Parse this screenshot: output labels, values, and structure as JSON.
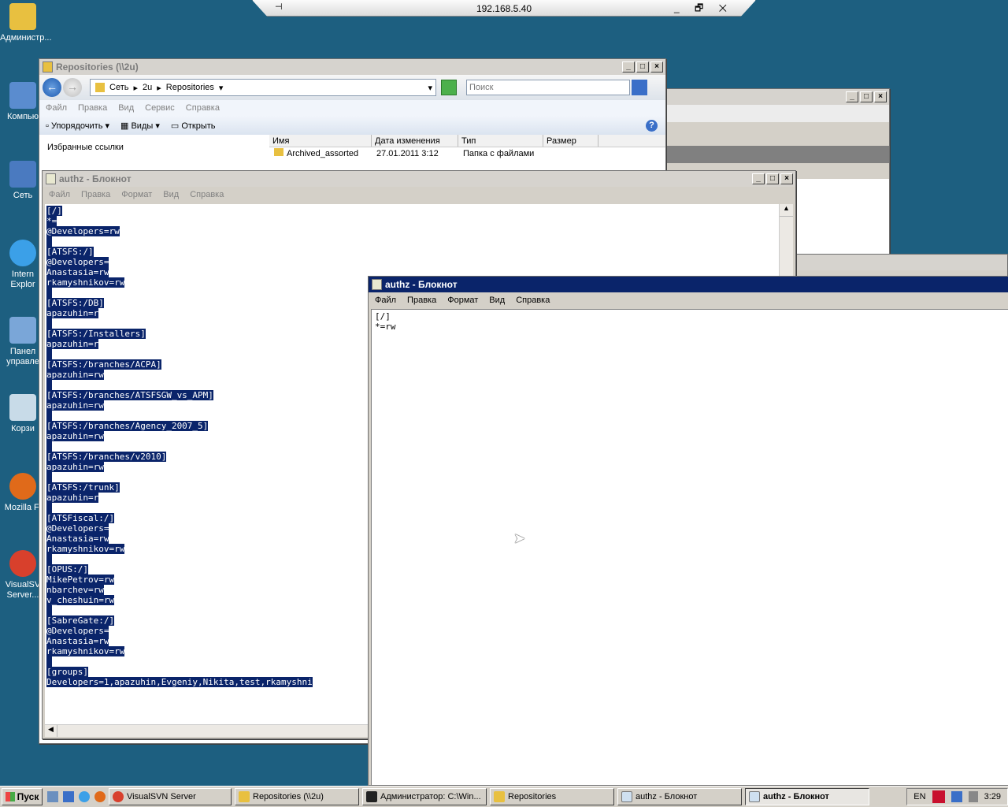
{
  "remote": {
    "ip": "192.168.5.40",
    "pin": "⊣",
    "controls": "_ 🗗 ✕"
  },
  "desktop_icons": [
    "Администр...",
    "Компью",
    "Сеть",
    "Intern Explor",
    "Панел управле",
    "Корзи",
    "Mozilla Fi",
    "VisualSV Server..."
  ],
  "explorer": {
    "title": "Repositories (\\\\2u)",
    "breadcrumb": [
      "Сеть",
      "2u",
      "Repositories"
    ],
    "search_placeholder": "Поиск",
    "menu": [
      "Файл",
      "Правка",
      "Вид",
      "Сервис",
      "Справка"
    ],
    "toolbar": [
      "Упорядочить",
      "Виды",
      "Открыть"
    ],
    "favorites": "Избранные ссылки",
    "columns": [
      "Имя",
      "Дата изменения",
      "Тип",
      "Размер"
    ],
    "row": {
      "name": "Archived_assorted",
      "date": "27.01.2011 3:12",
      "type": "Папка с файлами"
    }
  },
  "notepad1": {
    "title": "authz - Блокнот",
    "menu": [
      "Файл",
      "Правка",
      "Формат",
      "Вид",
      "Справка"
    ],
    "lines": [
      "[/]",
      "*=",
      "@Developers=rw",
      "",
      "[ATSFS:/]",
      "@Developers=",
      "Anastasia=rw",
      "rkamyshnikov=rw",
      "",
      "[ATSFS:/DB]",
      "apazuhin=r",
      "",
      "[ATSFS:/Installers]",
      "apazuhin=r",
      "",
      "[ATSFS:/branches/ACPA]",
      "apazuhin=rw",
      "",
      "[ATSFS:/branches/ATSFSGW_vs_APM]",
      "apazuhin=rw",
      "",
      "[ATSFS:/branches/Agency_2007_5]",
      "apazuhin=rw",
      "",
      "[ATSFS:/branches/v2010]",
      "apazuhin=rw",
      "",
      "[ATSFS:/trunk]",
      "apazuhin=r",
      "",
      "[ATSFiscal:/]",
      "@Developers=",
      "Anastasia=rw",
      "rkamyshnikov=rw",
      "",
      "[OPUS:/]",
      "MikePetrov=rw",
      "nbarchev=rw",
      "v_cheshuin=rw",
      "",
      "[SabreGate:/]",
      "@Developers=",
      "Anastasia=rw",
      "rkamyshnikov=rw",
      "",
      "[groups]",
      "Developers=1,apazuhin,Evgeniy,Nikita,test,rkamyshni"
    ]
  },
  "notepad2": {
    "title": "authz - Блокнот",
    "menu": [
      "Файл",
      "Правка",
      "Формат",
      "Вид",
      "Справка"
    ],
    "lines": [
      "[/]",
      "*=rw"
    ]
  },
  "taskbar": {
    "start": "Пуск",
    "tasks": [
      "VisualSVN Server",
      "Repositories (\\\\2u)",
      "Администратор: C:\\Win...",
      "Repositories",
      "authz - Блокнот",
      "authz - Блокнот"
    ],
    "lang": "EN",
    "clock": "3:29"
  }
}
